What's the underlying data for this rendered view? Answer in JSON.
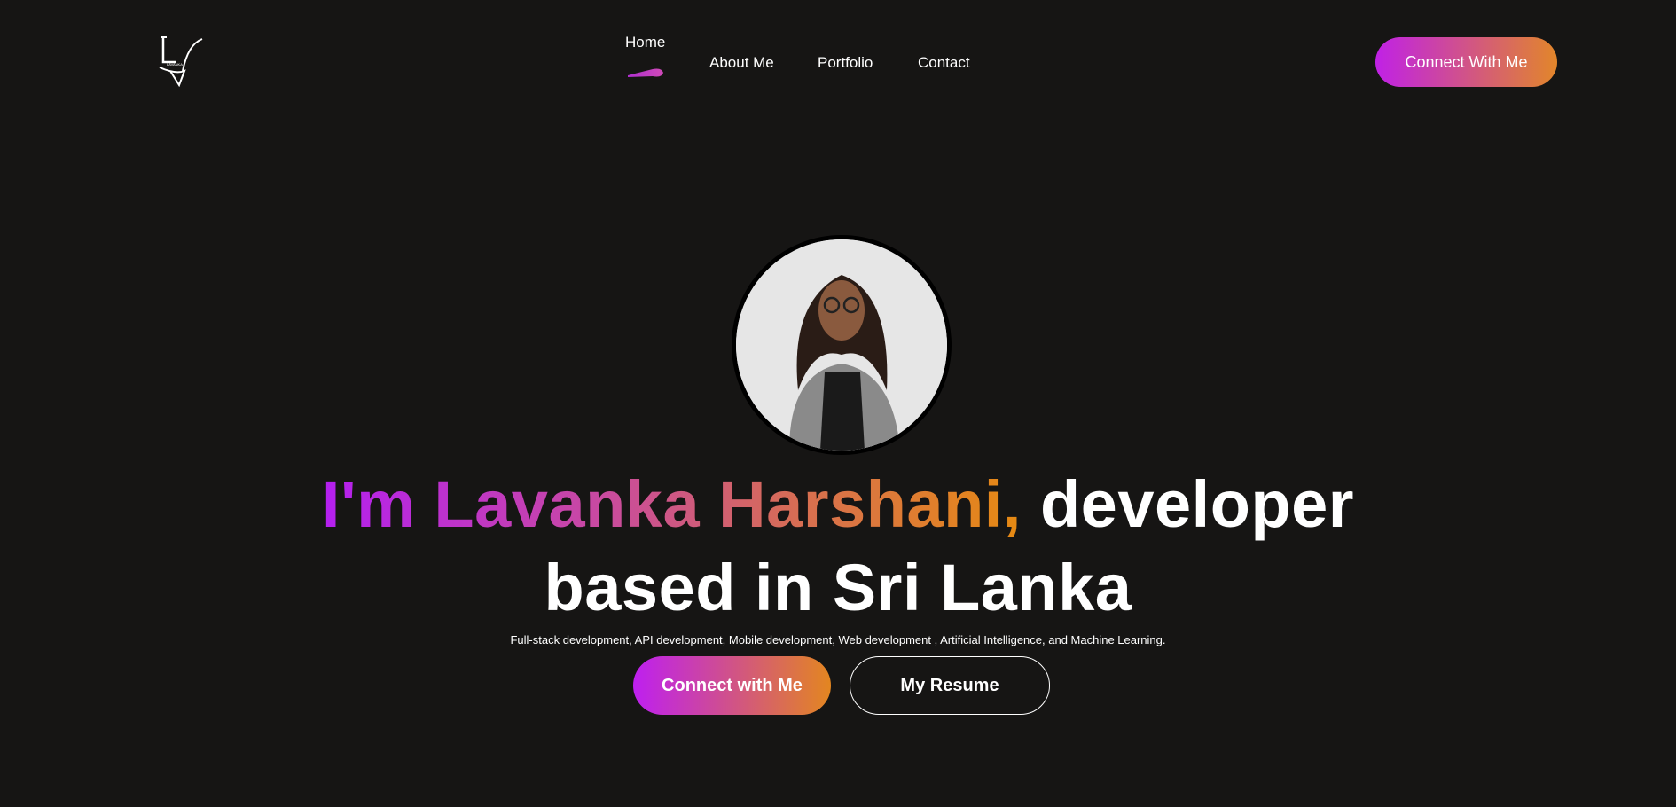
{
  "logo": {
    "text": "LV",
    "brand": "LAVANKA"
  },
  "nav": {
    "items": [
      {
        "label": "Home",
        "active": true
      },
      {
        "label": "About Me"
      },
      {
        "label": "Portfolio"
      },
      {
        "label": "Contact"
      }
    ]
  },
  "header": {
    "cta_label": "Connect With Me"
  },
  "hero": {
    "name_part": "I'm Lavanka Harshani,",
    "rest_line1": " developer",
    "line2": "based in Sri Lanka",
    "subtitle": "Full-stack development, API development, Mobile development, Web development , Artificial Intelligence, and Machine Learning.",
    "primary_button": "Connect with Me",
    "secondary_button": "My Resume"
  },
  "colors": {
    "background": "#161514",
    "gradient_start": "#b41ff0",
    "gradient_end": "#e68a12"
  }
}
